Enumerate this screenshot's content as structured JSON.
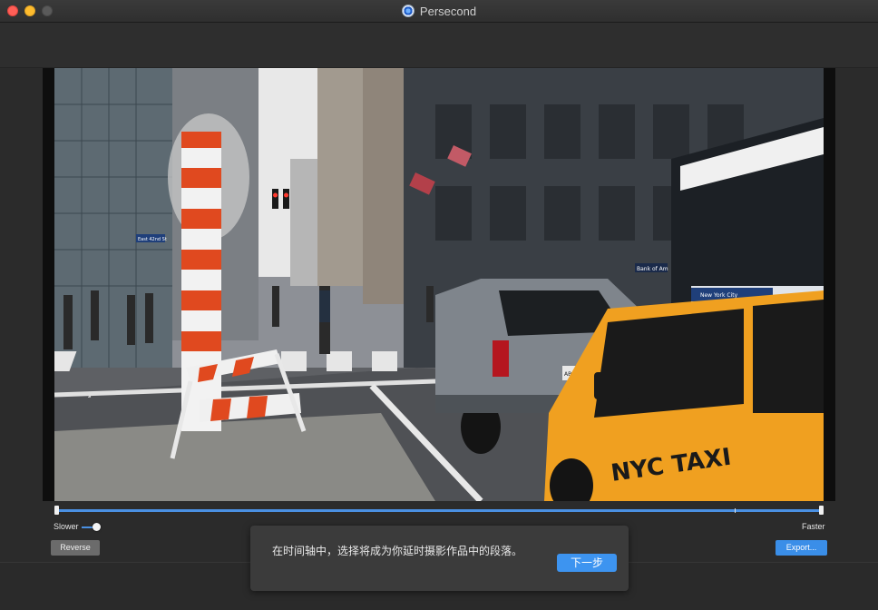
{
  "window": {
    "title": "Persecond",
    "app_icon": "persecond-app-icon"
  },
  "timeline": {
    "selection_start": 0.0,
    "selection_end": 1.0,
    "marker_position": 0.885
  },
  "speed": {
    "slower_label": "Slower",
    "faster_label": "Faster",
    "value": 0.2
  },
  "buttons": {
    "reverse_label": "Reverse",
    "export_label": "Export..."
  },
  "tip": {
    "text": "在时间轴中，选择将成为你延时摄影作品中的段落。",
    "next_label": "下一步"
  },
  "video": {
    "scene": {
      "street_sign": "East 42nd St",
      "taxi_text": "NYC TAXI",
      "shop_sign": "Bank of Am",
      "plate": "ABC 1234",
      "bus_text": "New York City"
    }
  },
  "colors": {
    "accent": "#3d94f0",
    "timeline": "#4a90e2",
    "window_bg": "#2b2b2b"
  }
}
